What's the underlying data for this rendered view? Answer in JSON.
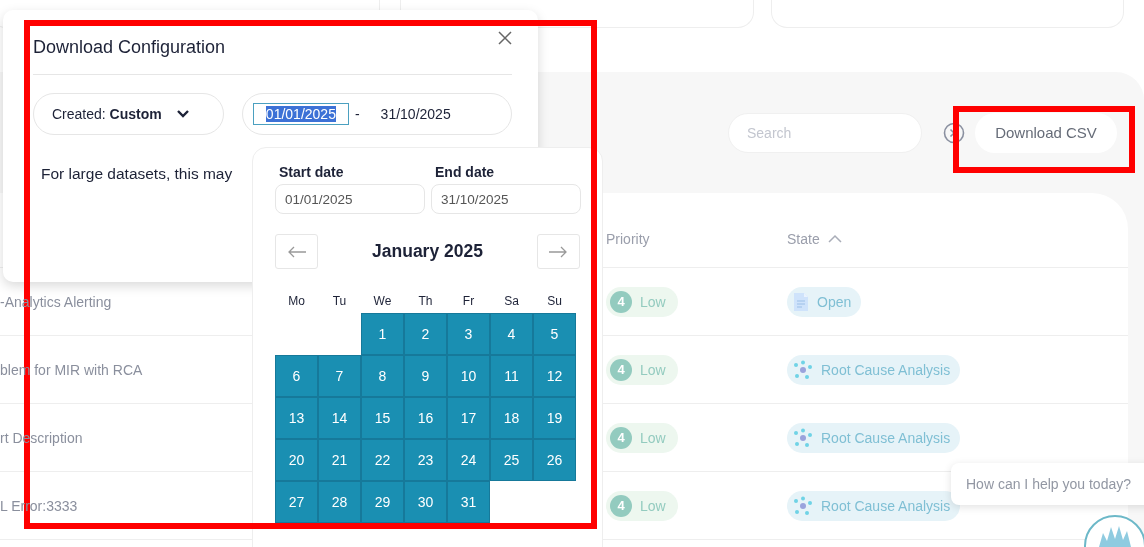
{
  "toolbar": {
    "search": {
      "placeholder": "Search"
    },
    "download_button": "Download CSV"
  },
  "table": {
    "columns": [
      {
        "label": "Priority",
        "sorted": false
      },
      {
        "label": "State",
        "sorted": true
      }
    ],
    "rows": [
      {
        "title": "-Analytics Alerting",
        "priority": {
          "number": "4",
          "label": "Low"
        },
        "state": {
          "kind": "open",
          "label": "Open"
        }
      },
      {
        "title": "blem for MIR with RCA",
        "priority": {
          "number": "4",
          "label": "Low"
        },
        "state": {
          "kind": "rca",
          "label": "Root Cause Analysis"
        }
      },
      {
        "title": "rt Description",
        "priority": {
          "number": "4",
          "label": "Low"
        },
        "state": {
          "kind": "rca",
          "label": "Root Cause Analysis"
        }
      },
      {
        "title": "L Error:3333",
        "priority": {
          "number": "4",
          "label": "Low"
        },
        "state": {
          "kind": "rca",
          "label": "Root Cause Analysis"
        }
      }
    ]
  },
  "dialog": {
    "title": "Download Configuration",
    "created": {
      "label": "Created:",
      "value": "Custom"
    },
    "range": {
      "start": {
        "value": "01/01/2025",
        "selected": true
      },
      "separator": "-",
      "end": {
        "value": "31/10/2025",
        "selected": false
      }
    },
    "note": "For large datasets, this may"
  },
  "calendar": {
    "start_label": "Start date",
    "start_value": "01/01/2025",
    "end_label": "End date",
    "end_value": "31/10/2025",
    "month": "January 2025",
    "weekdays": [
      "Mo",
      "Tu",
      "We",
      "Th",
      "Fr",
      "Sa",
      "Su"
    ],
    "weeks": [
      {
        "days": [
          {
            "day": "1",
            "in_range": true
          },
          {
            "day": "2",
            "in_range": true
          },
          {
            "day": "3",
            "in_range": true
          },
          {
            "day": "4",
            "in_range": true
          },
          {
            "day": "5",
            "in_range": true
          }
        ]
      },
      {
        "days": [
          {
            "day": "6",
            "in_range": true
          },
          {
            "day": "7",
            "in_range": true
          },
          {
            "day": "8",
            "in_range": true
          },
          {
            "day": "9",
            "in_range": true
          },
          {
            "day": "10",
            "in_range": true
          },
          {
            "day": "11",
            "in_range": true
          },
          {
            "day": "12",
            "in_range": true
          }
        ]
      },
      {
        "days": [
          {
            "day": "13",
            "in_range": true
          },
          {
            "day": "14",
            "in_range": true
          },
          {
            "day": "15",
            "in_range": true
          },
          {
            "day": "16",
            "in_range": true
          },
          {
            "day": "17",
            "in_range": true
          },
          {
            "day": "18",
            "in_range": true
          },
          {
            "day": "19",
            "in_range": true
          }
        ]
      },
      {
        "days": [
          {
            "day": "20",
            "in_range": true
          },
          {
            "day": "21",
            "in_range": true
          },
          {
            "day": "22",
            "in_range": true
          },
          {
            "day": "23",
            "in_range": true
          },
          {
            "day": "24",
            "in_range": true
          },
          {
            "day": "25",
            "in_range": true
          },
          {
            "day": "26",
            "in_range": true
          }
        ]
      },
      {
        "days": [
          {
            "day": "27",
            "in_range": true
          },
          {
            "day": "28",
            "in_range": true
          },
          {
            "day": "29",
            "in_range": true
          },
          {
            "day": "30",
            "in_range": true
          },
          {
            "day": "31",
            "in_range": true
          }
        ]
      }
    ]
  },
  "chat": {
    "prompt": "How can I help you today?"
  },
  "highlights": {
    "dialog": true,
    "download_button": true
  }
}
